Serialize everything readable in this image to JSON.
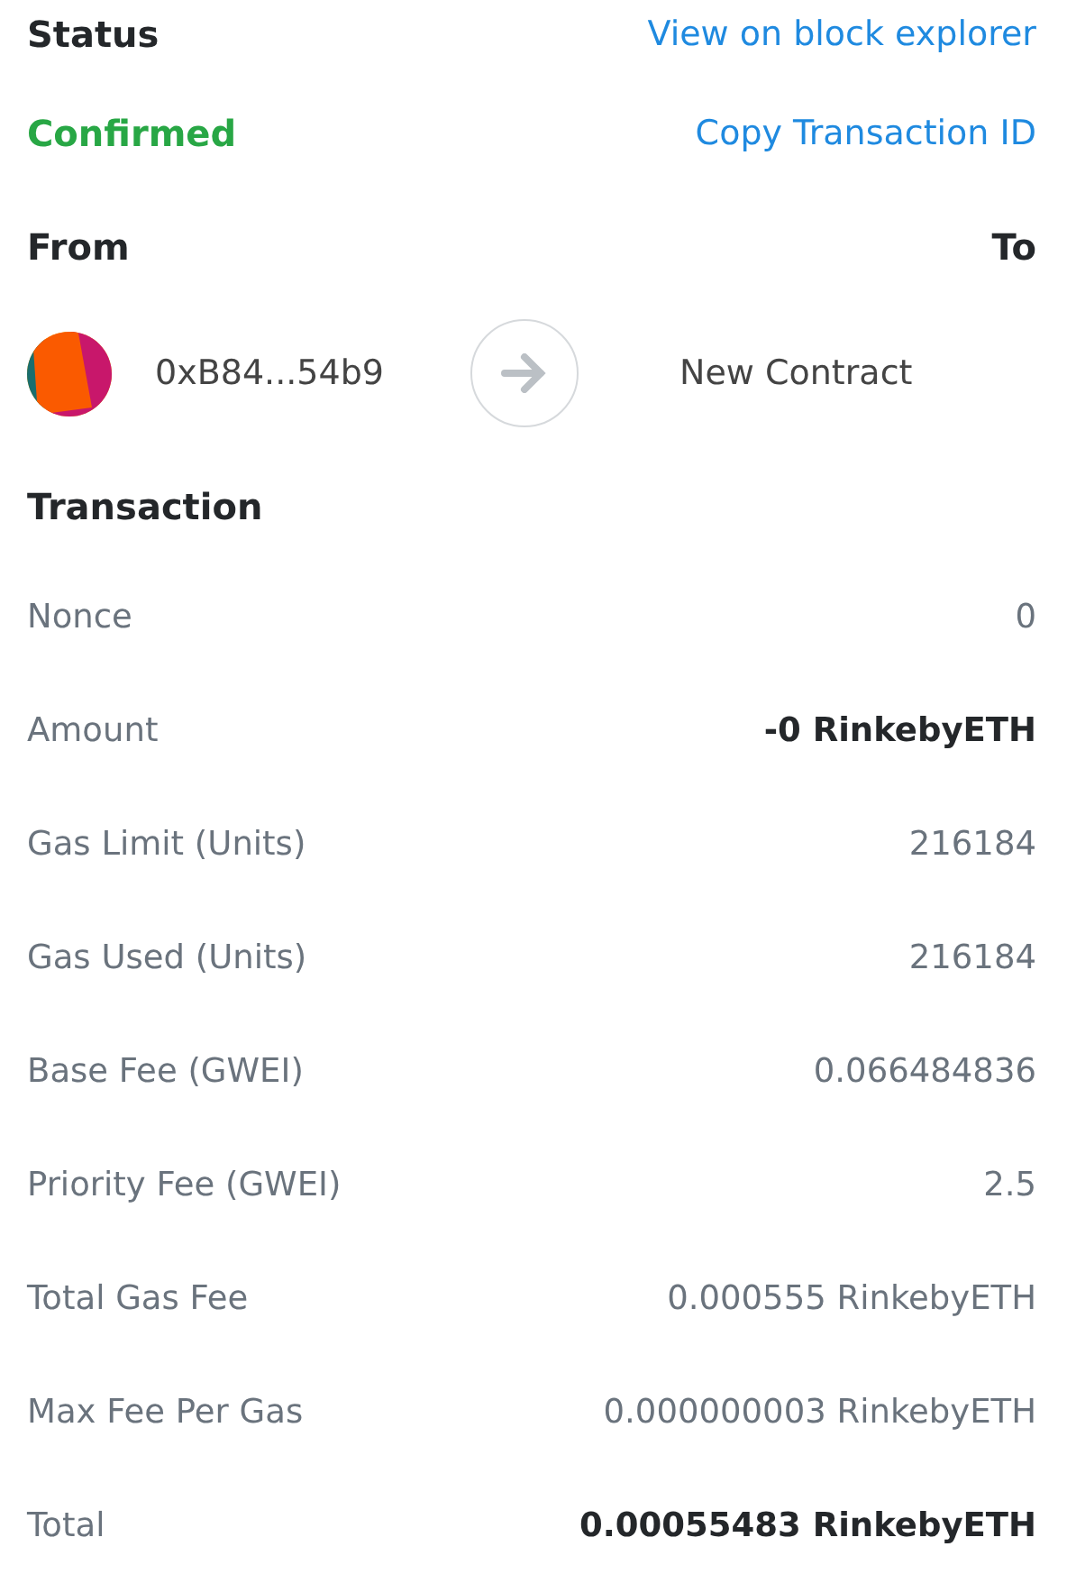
{
  "status": {
    "heading": "Status",
    "value": "Confirmed",
    "color": "#28a745"
  },
  "links": [
    "View on block explorer",
    "Copy Transaction ID"
  ],
  "from_to": {
    "from_heading": "From",
    "to_heading": "To",
    "from_address": "0xB84...54b9",
    "to_label": "New Contract"
  },
  "transaction": {
    "heading": "Transaction",
    "rows": [
      {
        "label": "Nonce",
        "value": "0",
        "bold": false
      },
      {
        "label": "Amount",
        "value": "-0 RinkebyETH",
        "bold": true
      },
      {
        "label": "Gas Limit (Units)",
        "value": "216184",
        "bold": false
      },
      {
        "label": "Gas Used (Units)",
        "value": "216184",
        "bold": false
      },
      {
        "label": "Base Fee (GWEI)",
        "value": "0.066484836",
        "bold": false
      },
      {
        "label": "Priority Fee (GWEI)",
        "value": "2.5",
        "bold": false
      },
      {
        "label": "Total Gas Fee",
        "value": "0.000555 RinkebyETH",
        "bold": false
      },
      {
        "label": "Max Fee Per Gas",
        "value": "0.000000003 RinkebyETH",
        "bold": false
      },
      {
        "label": "Total",
        "value": "0.00055483 RinkebyETH",
        "bold": true
      }
    ]
  }
}
